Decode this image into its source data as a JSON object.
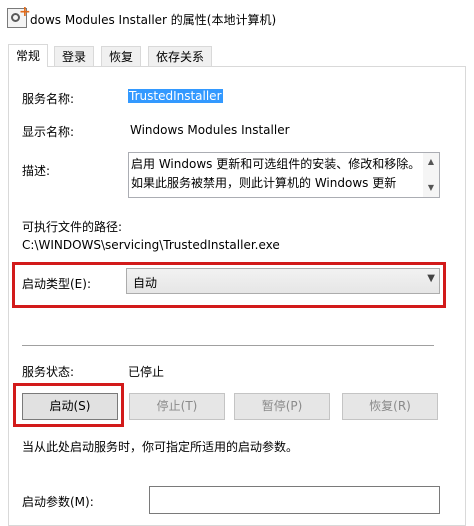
{
  "window": {
    "title": "dows Modules Installer 的属性(本地计算机)",
    "icon": "service-gear-plus-icon"
  },
  "tabs": [
    {
      "label": "常规",
      "active": true
    },
    {
      "label": "登录",
      "active": false
    },
    {
      "label": "恢复",
      "active": false
    },
    {
      "label": "依存关系",
      "active": false
    }
  ],
  "general": {
    "service_name_label": "服务名称:",
    "service_name_value": "TrustedInstaller",
    "display_name_label": "显示名称:",
    "display_name_value": "Windows Modules Installer",
    "description_label": "描述:",
    "description_value": "启用 Windows 更新和可选组件的安装、修改和移除。如果此服务被禁用，则此计算机的 Windows 更新",
    "exe_path_label": "可执行文件的路径:",
    "exe_path_value": "C:\\WINDOWS\\servicing\\TrustedInstaller.exe",
    "startup_type_label": "启动类型(E):",
    "startup_type_value": "自动",
    "service_status_label": "服务状态:",
    "service_status_value": "已停止",
    "buttons": {
      "start": "启动(S)",
      "stop": "停止(T)",
      "pause": "暂停(P)",
      "resume": "恢复(R)"
    },
    "hint_text": "当从此处启动服务时，你可指定所适用的启动参数。",
    "start_params_label": "启动参数(M):",
    "start_params_value": ""
  },
  "colors": {
    "highlight_box": "#d21a1a",
    "selection": "#3399ff"
  }
}
